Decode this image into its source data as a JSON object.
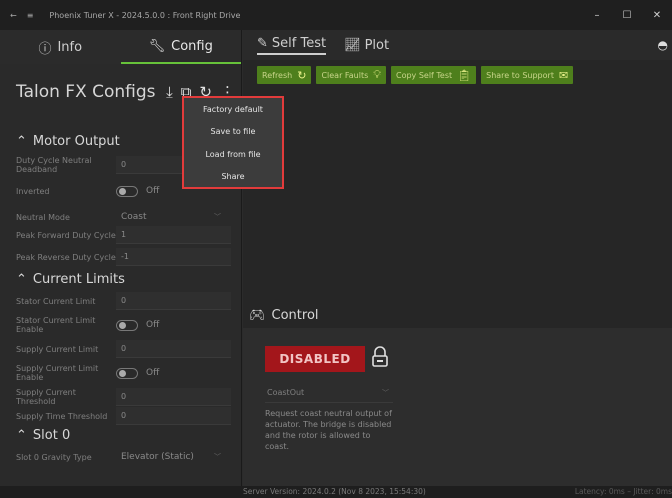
{
  "window": {
    "title": "Phoenix Tuner X - 2024.5.0.0 : Front Right Drive",
    "controls": [
      "–",
      "☐",
      "✕"
    ]
  },
  "left_tabs": [
    {
      "label": "Info",
      "icon": "info-icon"
    },
    {
      "label": "Config",
      "icon": "wrench-icon"
    }
  ],
  "configs": {
    "title": "Talon FX Configs"
  },
  "sections": {
    "motor_output": "Motor Output",
    "current_limits": "Current Limits",
    "slot0": "Slot 0"
  },
  "rows": {
    "duty_deadband": {
      "label": "Duty Cycle Neutral Deadband",
      "value": "0"
    },
    "inverted": {
      "label": "Inverted",
      "value": "Off"
    },
    "neutral_mode": {
      "label": "Neutral Mode",
      "value": "Coast"
    },
    "peak_fwd": {
      "label": "Peak Forward Duty Cycle",
      "value": "1"
    },
    "peak_rev": {
      "label": "Peak Reverse Duty Cycle",
      "value": "-1"
    },
    "stator_limit": {
      "label": "Stator Current Limit",
      "value": "0"
    },
    "stator_enable": {
      "label": "Stator Current Limit Enable",
      "value": "Off"
    },
    "supply_limit": {
      "label": "Supply Current Limit",
      "value": "0"
    },
    "supply_enable": {
      "label": "Supply Current Limit Enable",
      "value": "Off"
    },
    "supply_threshold": {
      "label": "Supply Current Threshold",
      "value": "0"
    },
    "supply_time": {
      "label": "Supply Time Threshold",
      "value": "0"
    },
    "gravity_type": {
      "label": "Slot 0 Gravity Type",
      "value": "Elevator (Static)"
    }
  },
  "right_tabs": [
    {
      "label": "Self Test",
      "icon": "self-test-icon"
    },
    {
      "label": "Plot",
      "icon": "plot-icon"
    }
  ],
  "buttons": {
    "refresh": "Refresh",
    "clear_faults": "Clear Faults",
    "copy_self_test": "Copy Self Test",
    "share_support": "Share to Support"
  },
  "control": {
    "title": "Control",
    "disabled_label": "DISABLED",
    "mode": "CoastOut",
    "description": "Request coast neutral output of actuator.  The bridge is disabled and the rotor is allowed to coast."
  },
  "context_menu": [
    "Factory default",
    "Save to file",
    "Load from file",
    "Share"
  ],
  "status": {
    "server_version": "Server Version:  2024.0.2 (Nov  8 2023, 15:54:30)",
    "latency": "Latency: 0ms – Jitter: 0ms"
  },
  "colors": {
    "accent_green": "#67c23a",
    "button_green": "#4e7f1c",
    "disabled_red": "#a3161b",
    "highlight_red": "#e23b3b"
  }
}
